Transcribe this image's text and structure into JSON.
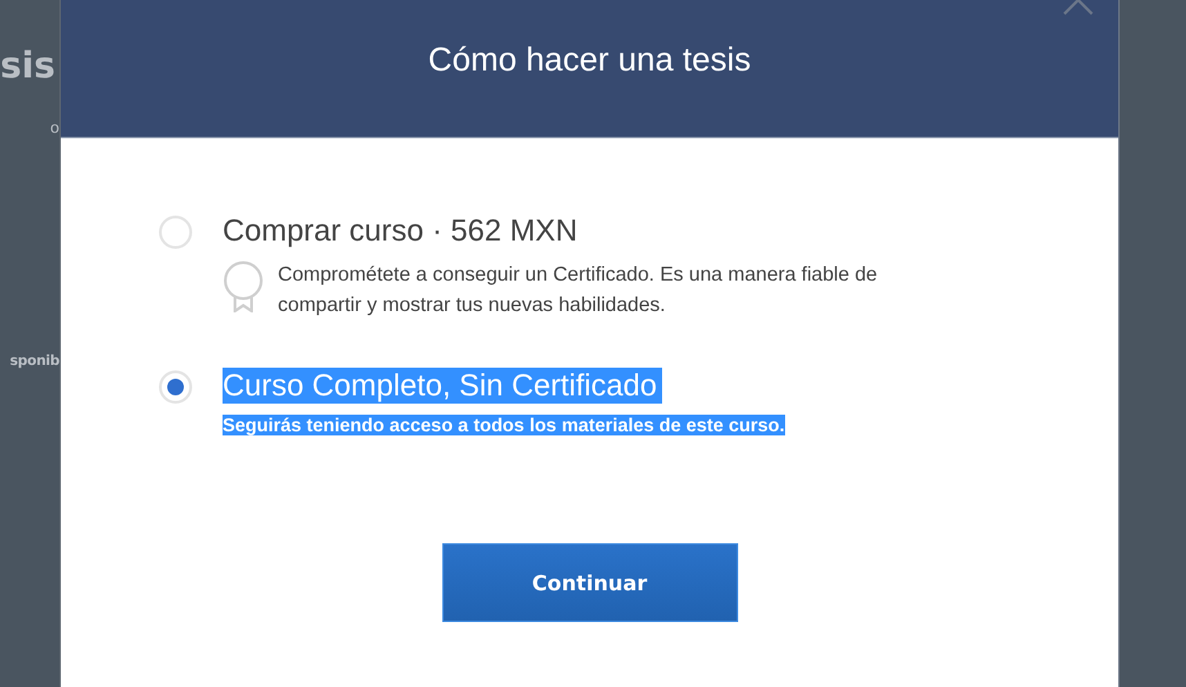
{
  "background_page": {
    "title_fragment": "sis",
    "line_fragment": "o",
    "status_fragment": "sponib"
  },
  "dialog": {
    "title": "Cómo hacer una tesis",
    "options": [
      {
        "label": "Comprar curso · 562 MXN",
        "description": "Comprométete a conseguir un Certificado. Es una manera fiable de compartir y mostrar tus nuevas habilidades.",
        "kind": "certificate",
        "selected": false,
        "highlighted": false
      },
      {
        "label": "Curso Completo, Sin Certificado",
        "description": "Seguirás teniendo acceso a todos los materiales de este curso.",
        "kind": "plain",
        "selected": true,
        "highlighted": true
      }
    ],
    "button": "Continuar"
  }
}
